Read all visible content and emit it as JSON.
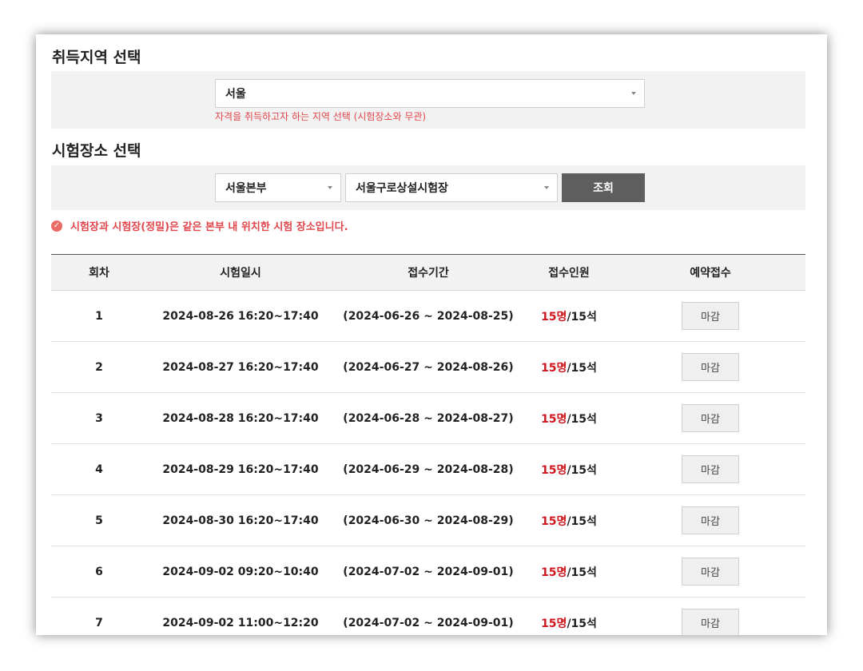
{
  "region": {
    "title": "취득지역 선택",
    "selected": "서울",
    "hint": "자격을 취득하고자 하는 지역 선택 (시험장소와 무관)"
  },
  "venue": {
    "title": "시험장소 선택",
    "branch": "서울본부",
    "site": "서울구로상설시험장",
    "query_label": "조회",
    "notice": "시험장과 시험장(정밀)은 같은 본부 내 위치한 시험 장소입니다."
  },
  "table": {
    "headers": [
      "회차",
      "시험일시",
      "접수기간",
      "접수인원",
      "예약접수"
    ],
    "rows": [
      {
        "no": "1",
        "datetime": "2024-08-26 16:20~17:40",
        "period": "(2024-06-26 ~ 2024-08-25)",
        "applied": "15명",
        "capacity": "/15석",
        "action": "마감"
      },
      {
        "no": "2",
        "datetime": "2024-08-27 16:20~17:40",
        "period": "(2024-06-27 ~ 2024-08-26)",
        "applied": "15명",
        "capacity": "/15석",
        "action": "마감"
      },
      {
        "no": "3",
        "datetime": "2024-08-28 16:20~17:40",
        "period": "(2024-06-28 ~ 2024-08-27)",
        "applied": "15명",
        "capacity": "/15석",
        "action": "마감"
      },
      {
        "no": "4",
        "datetime": "2024-08-29 16:20~17:40",
        "period": "(2024-06-29 ~ 2024-08-28)",
        "applied": "15명",
        "capacity": "/15석",
        "action": "마감"
      },
      {
        "no": "5",
        "datetime": "2024-08-30 16:20~17:40",
        "period": "(2024-06-30 ~ 2024-08-29)",
        "applied": "15명",
        "capacity": "/15석",
        "action": "마감"
      },
      {
        "no": "6",
        "datetime": "2024-09-02 09:20~10:40",
        "period": "(2024-07-02 ~ 2024-09-01)",
        "applied": "15명",
        "capacity": "/15석",
        "action": "마감"
      },
      {
        "no": "7",
        "datetime": "2024-09-02 11:00~12:20",
        "period": "(2024-07-02 ~ 2024-09-01)",
        "applied": "15명",
        "capacity": "/15석",
        "action": "마감"
      }
    ]
  },
  "colors": {
    "accent_red": "#d0161f",
    "hint_red": "#e0464b",
    "query_button": "#5e5e5e"
  }
}
